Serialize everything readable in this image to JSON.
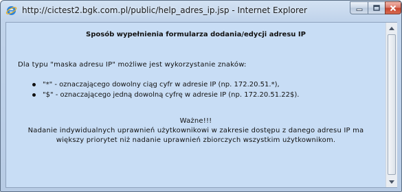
{
  "window": {
    "title": "http://cictest2.bgk.com.pl/public/help_adres_ip.jsp - Internet Explorer"
  },
  "content": {
    "heading": "Sposób wypełnienia formularza dodania/edycji adresu IP",
    "intro": "Dla typu \"maska adresu IP\" możliwe jest wykorzystanie znaków:",
    "bullets": [
      "\"*\" - oznaczającego dowolny ciąg cyfr w adresie IP (np. 172.20.51.*),",
      "\"$\" - oznaczającego jedną dowolną cyfrę w adresie IP (np. 172.20.51.22$)."
    ],
    "note_title": "Ważne!!!",
    "note_line1": "Nadanie indywidualnych uprawnień użytkownikowi w zakresie dostępu z danego adresu IP ma",
    "note_line2": "większy priorytet niż nadanie uprawnień zbiorczych wszystkim użytkownikom."
  },
  "icons": {
    "app": "internet-explorer-icon",
    "minimize": "minimize-icon",
    "maximize": "maximize-icon",
    "close": "close-icon",
    "scroll_up": "scroll-up-arrow-icon",
    "scroll_down": "scroll-down-arrow-icon"
  }
}
